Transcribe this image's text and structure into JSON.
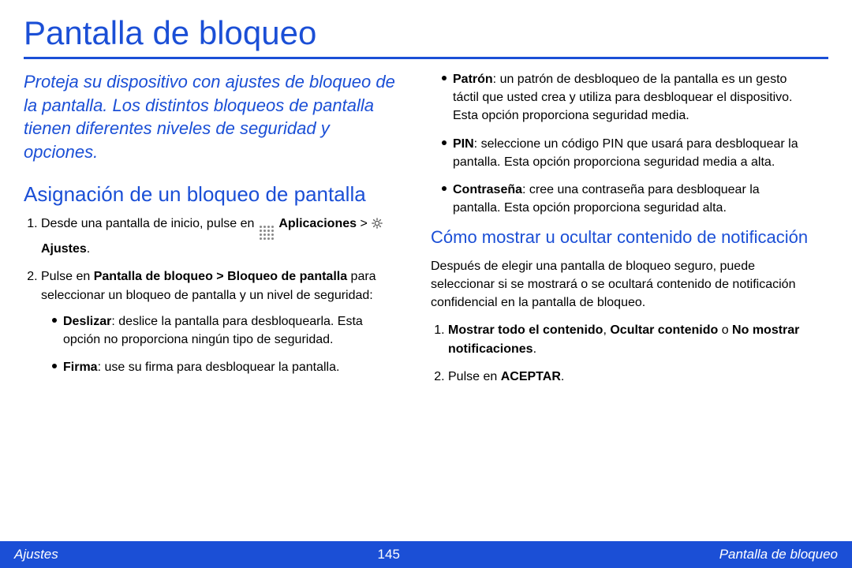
{
  "title": "Pantalla de bloqueo",
  "intro": "Proteja su dispositivo con ajustes de bloqueo de la pantalla. Los distintos bloqueos de pantalla tienen diferentes niveles de seguridad y opciones.",
  "section1_heading": "Asignación de un bloqueo de pantalla",
  "step1_pre": "Desde una pantalla de inicio, pulse en ",
  "step1_apps": "Aplicaciones",
  "step1_gt": " > ",
  "step1_settings": " Ajustes",
  "step1_end": ".",
  "step2_pre": "Pulse en ",
  "step2_path": "Pantalla de bloqueo > Bloqueo de pantalla",
  "step2_post": " para seleccionar un bloqueo de pantalla y un nivel de seguridad:",
  "bullets_left": [
    {
      "term": "Deslizar",
      "text": ": deslice la pantalla para desbloquearla. Esta opción no proporciona ningún tipo de seguridad."
    },
    {
      "term": "Firma",
      "text": ": use su firma para desbloquear la pantalla."
    }
  ],
  "bullets_right": [
    {
      "term": "Patrón",
      "text": ": un patrón de desbloqueo de la pantalla es un gesto táctil que usted crea y utiliza para desbloquear el dispositivo. Esta opción proporciona seguridad media."
    },
    {
      "term": "PIN",
      "text": ": seleccione un código PIN que usará para desbloquear la pantalla. Esta opción proporciona seguridad media a alta."
    },
    {
      "term": "Contraseña",
      "text": ": cree una contraseña para desbloquear la pantalla. Esta opción proporciona seguridad alta."
    }
  ],
  "section2_heading": "Cómo mostrar u ocultar contenido de notificación",
  "section2_para": "Después de elegir una pantalla de bloqueo seguro, puede seleccionar si se mostrará o se ocultará contenido de notificación confidencial en la pantalla de bloqueo.",
  "opt_show": "Mostrar todo el contenido",
  "opt_sep1": ", ",
  "opt_hide": "Ocultar contenido",
  "opt_or": " o ",
  "opt_none": "No mostrar notificaciones",
  "opt_end": ".",
  "accept_pre": "Pulse en ",
  "accept_bold": "ACEPTAR",
  "accept_end": ".",
  "footer": {
    "left": "Ajustes",
    "page": "145",
    "right": "Pantalla de bloqueo"
  }
}
